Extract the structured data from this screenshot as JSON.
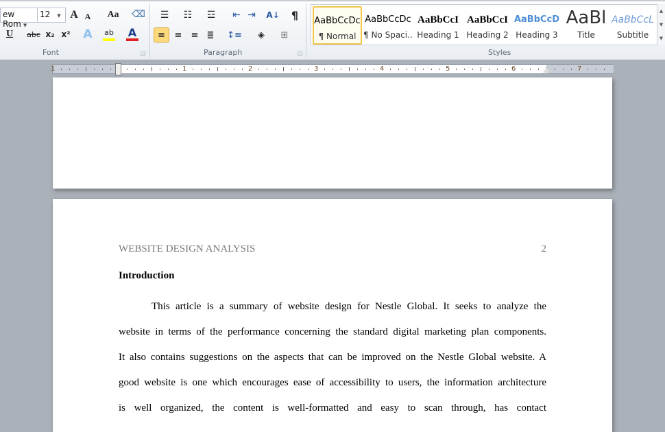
{
  "ribbon": {
    "font": {
      "name": "ew Rom",
      "size": "12",
      "label": "Font",
      "grow": "A",
      "shrink": "A",
      "case": "Aa",
      "underline": "U",
      "strike": "abc",
      "subscript": "x₂",
      "superscript": "x²",
      "effects": "A",
      "highlight": "ab",
      "color": "A",
      "highlight_color": "#ffff00",
      "font_color": "#e02020"
    },
    "paragraph": {
      "label": "Paragraph",
      "pilcrow": "¶",
      "sort": "A↓"
    },
    "styles": {
      "label": "Styles",
      "items": [
        {
          "preview": "AaBbCcDc",
          "name": "¶ Normal",
          "selected": true
        },
        {
          "preview": "AaBbCcDc",
          "name": "¶ No Spaci..."
        },
        {
          "preview": "AaBbCcI",
          "name": "Heading 1"
        },
        {
          "preview": "AaBbCcI",
          "name": "Heading 2"
        },
        {
          "preview": "AaBbCcD",
          "name": "Heading 3"
        },
        {
          "preview": "AaBl",
          "name": "Title"
        },
        {
          "preview": "AaBbCcL",
          "name": "Subtitle"
        }
      ]
    }
  },
  "ruler": {
    "numbers": [
      "1",
      "1",
      "2",
      "3",
      "4",
      "5",
      "6",
      "7"
    ]
  },
  "document": {
    "header": "WEBSITE DESIGN ANALYSIS",
    "page_number": "2",
    "heading": "Introduction",
    "lines": [
      "This article is a summary of website design for Nestle Global. It seeks to analyze the",
      "website in terms of the performance concerning the standard digital marketing plan components.",
      "It also contains suggestions on the aspects that can be improved on the Nestle Global website. A",
      "good website is one which encourages ease of accessibility to users, the information architecture",
      "is well organized, the content is well-formatted and easy to scan through, has contact"
    ]
  }
}
